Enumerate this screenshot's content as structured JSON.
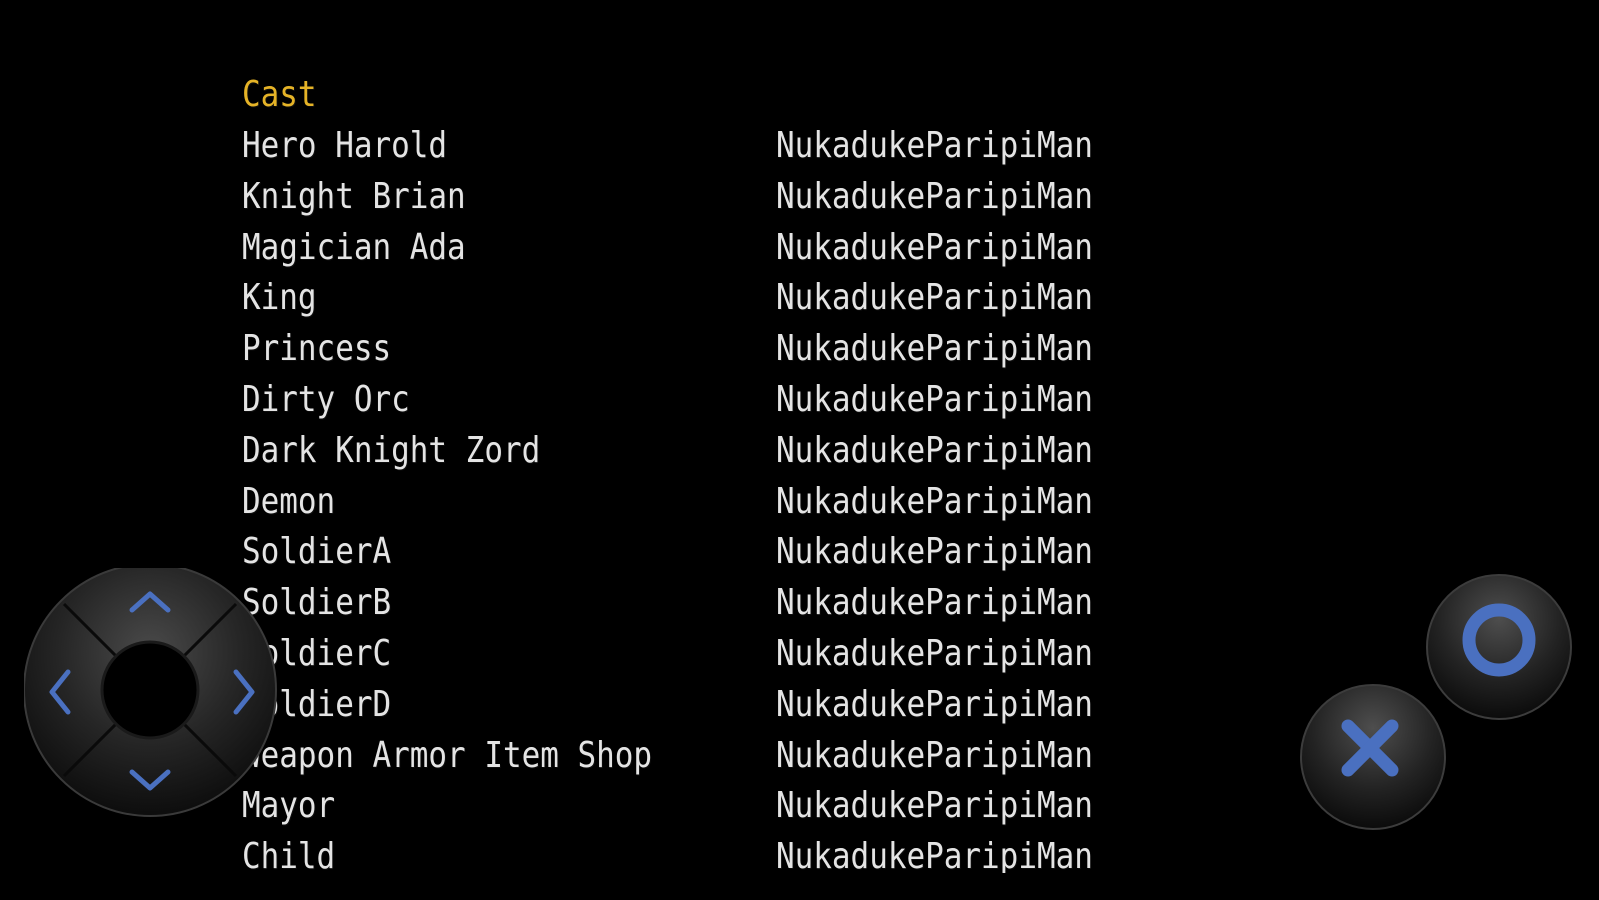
{
  "credits": {
    "section_title": "Cast",
    "entries": [
      {
        "role": "Hero Harold",
        "name": "NukadukeParipiMan"
      },
      {
        "role": "Knight Brian",
        "name": "NukadukeParipiMan"
      },
      {
        "role": "Magician Ada",
        "name": "NukadukeParipiMan"
      },
      {
        "role": "King",
        "name": "NukadukeParipiMan"
      },
      {
        "role": "Princess",
        "name": "NukadukeParipiMan"
      },
      {
        "role": "Dirty Orc",
        "name": "NukadukeParipiMan"
      },
      {
        "role": "Dark Knight Zord",
        "name": "NukadukeParipiMan"
      },
      {
        "role": "Demon",
        "name": "NukadukeParipiMan"
      },
      {
        "role": "SoldierA",
        "name": "NukadukeParipiMan"
      },
      {
        "role": "SoldierB",
        "name": "NukadukeParipiMan"
      },
      {
        "role": "SoldierC",
        "name": "NukadukeParipiMan"
      },
      {
        "role": "SoldierD",
        "name": "NukadukeParipiMan"
      },
      {
        "role": "Weapon Armor Item Shop",
        "name": "NukadukeParipiMan"
      },
      {
        "role": "Mayor",
        "name": "NukadukeParipiMan"
      },
      {
        "role": "Child",
        "name": "NukadukeParipiMan"
      }
    ]
  },
  "controls": {
    "dpad": {
      "up_icon": "chevron-up-icon",
      "down_icon": "chevron-down-icon",
      "left_icon": "chevron-left-icon",
      "right_icon": "chevron-right-icon"
    },
    "confirm_icon": "circle-icon",
    "cancel_icon": "cross-icon"
  },
  "colors": {
    "background": "#000000",
    "text": "#e4e4e4",
    "section_title": "#e5b327",
    "button_accent": "#4a70c0"
  }
}
